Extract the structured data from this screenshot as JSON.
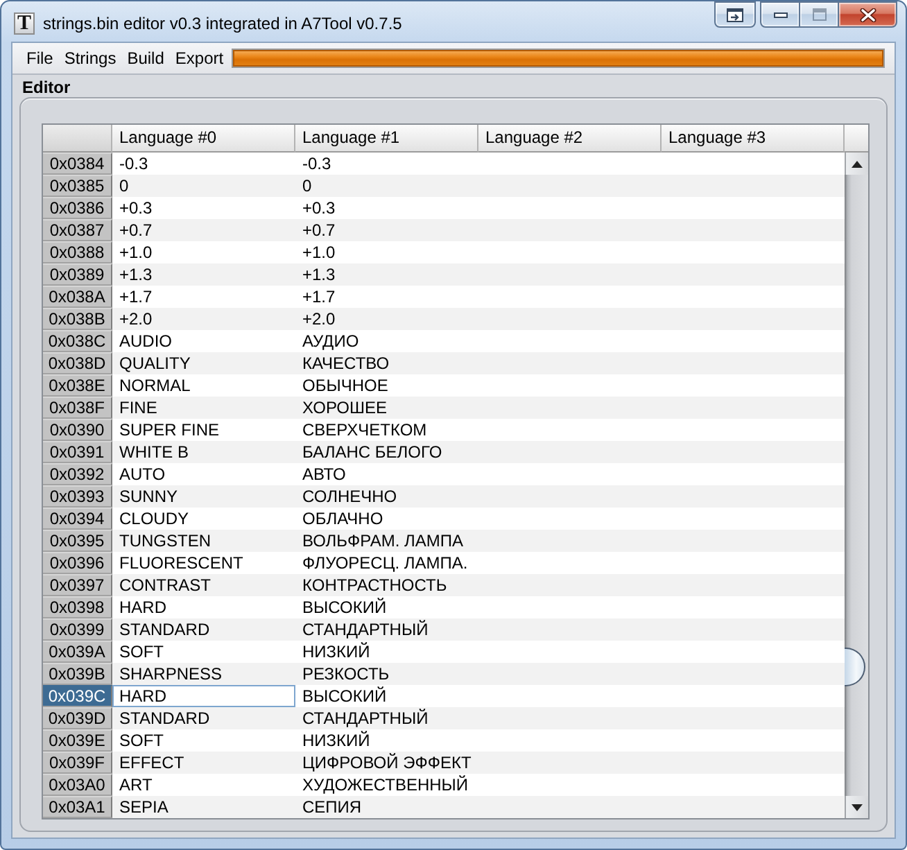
{
  "window": {
    "title": "strings.bin editor v0.3 integrated in A7Tool v0.7.5",
    "icon_letter": "T",
    "buttons": [
      {
        "kind": "extra",
        "disabled": false
      },
      {
        "kind": "minimize",
        "disabled": false
      },
      {
        "kind": "maximize",
        "disabled": true
      },
      {
        "kind": "close",
        "disabled": false
      }
    ]
  },
  "menu_bar": {
    "items": [
      "File",
      "Strings",
      "Build",
      "Export"
    ],
    "progress": {
      "level": 1
    }
  },
  "editor": {
    "title": "Editor",
    "table": {
      "columns": [
        "Language #0",
        "Language #1",
        "Language #2",
        "Language #3"
      ],
      "rows": [
        {
          "id": "0x0384",
          "cells": [
            "-0.3",
            "-0.3"
          ],
          "selected": false
        },
        {
          "id": "0x0385",
          "cells": [
            "0",
            "0"
          ],
          "selected": false
        },
        {
          "id": "0x0386",
          "cells": [
            "+0.3",
            "+0.3"
          ],
          "selected": false
        },
        {
          "id": "0x0387",
          "cells": [
            "+0.7",
            "+0.7"
          ],
          "selected": false
        },
        {
          "id": "0x0388",
          "cells": [
            "+1.0",
            "+1.0"
          ],
          "selected": false
        },
        {
          "id": "0x0389",
          "cells": [
            "+1.3",
            "+1.3"
          ],
          "selected": false
        },
        {
          "id": "0x038A",
          "cells": [
            "+1.7",
            "+1.7"
          ],
          "selected": false
        },
        {
          "id": "0x038B",
          "cells": [
            "+2.0",
            "+2.0"
          ],
          "selected": false
        },
        {
          "id": "0x038C",
          "cells": [
            "AUDIO",
            "АУДИО"
          ],
          "selected": false
        },
        {
          "id": "0x038D",
          "cells": [
            "QUALITY",
            "КАЧЕСТВО"
          ],
          "selected": false
        },
        {
          "id": "0x038E",
          "cells": [
            "NORMAL",
            "ОБЫЧНОЕ"
          ],
          "selected": false
        },
        {
          "id": "0x038F",
          "cells": [
            "FINE",
            "ХОРОШЕЕ"
          ],
          "selected": false
        },
        {
          "id": "0x0390",
          "cells": [
            "SUPER FINE",
            "СВЕРХЧЕТКОМ"
          ],
          "selected": false
        },
        {
          "id": "0x0391",
          "cells": [
            "WHITE B",
            "БАЛАНС БЕЛОГО"
          ],
          "selected": false
        },
        {
          "id": "0x0392",
          "cells": [
            "AUTO",
            "АВТО"
          ],
          "selected": false
        },
        {
          "id": "0x0393",
          "cells": [
            "SUNNY",
            "СОЛНЕЧНО"
          ],
          "selected": false
        },
        {
          "id": "0x0394",
          "cells": [
            "CLOUDY",
            "ОБЛАЧНО"
          ],
          "selected": false
        },
        {
          "id": "0x0395",
          "cells": [
            "TUNGSTEN",
            "ВОЛЬФРАМ. ЛАМПА"
          ],
          "selected": false
        },
        {
          "id": "0x0396",
          "cells": [
            "FLUORESCENT",
            "ФЛУОРЕСЦ. ЛАМПА."
          ],
          "selected": false
        },
        {
          "id": "0x0397",
          "cells": [
            "CONTRAST",
            "КОНТРАСТНОСТЬ"
          ],
          "selected": false
        },
        {
          "id": "0x0398",
          "cells": [
            "HARD",
            "ВЫСОКИЙ"
          ],
          "selected": false
        },
        {
          "id": "0x0399",
          "cells": [
            "STANDARD",
            "СТАНДАРТНЫЙ"
          ],
          "selected": false
        },
        {
          "id": "0x039A",
          "cells": [
            "SOFT",
            "НИЗКИЙ"
          ],
          "selected": false
        },
        {
          "id": "0x039B",
          "cells": [
            "SHARPNESS",
            "РЕЗКОСТЬ"
          ],
          "selected": false
        },
        {
          "id": "0x039C",
          "cells": [
            "HARD",
            "ВЫСОКИЙ"
          ],
          "selected": true
        },
        {
          "id": "0x039D",
          "cells": [
            "STANDARD",
            "СТАНДАРТНЫЙ"
          ],
          "selected": false
        },
        {
          "id": "0x039E",
          "cells": [
            "SOFT",
            "НИЗКИЙ"
          ],
          "selected": false
        },
        {
          "id": "0x039F",
          "cells": [
            "EFFECT",
            "ЦИФРОВОЙ ЭФФЕКТ"
          ],
          "selected": false
        },
        {
          "id": "0x03A0",
          "cells": [
            "ART",
            "ХУДОЖЕСТВЕННЫЙ"
          ],
          "selected": false
        },
        {
          "id": "0x03A1",
          "cells": [
            "SEPIA",
            "СЕПИЯ"
          ],
          "selected": false
        }
      ]
    }
  }
}
